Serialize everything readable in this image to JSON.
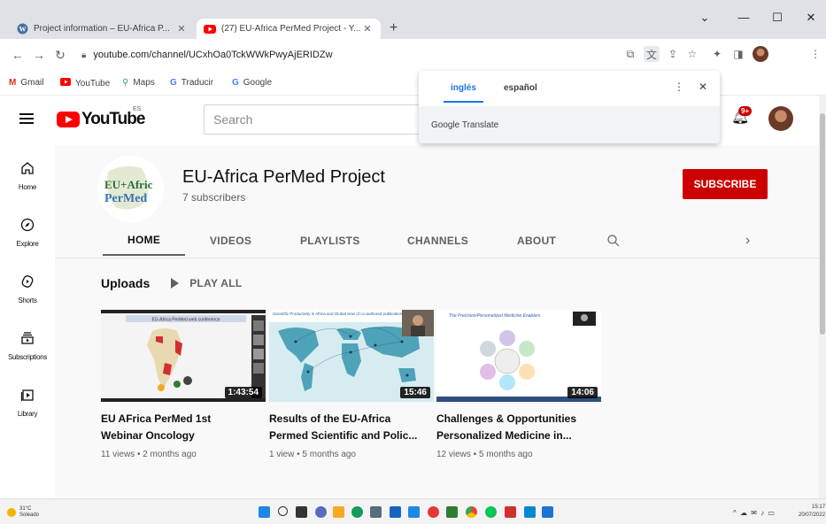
{
  "browser": {
    "tabs": [
      {
        "title": "Project information – EU-Africa P...",
        "active": false
      },
      {
        "title": "(27) EU-Africa PerMed Project - Y...",
        "active": true
      }
    ],
    "new_tab": "+",
    "window_controls": [
      "⌄",
      "—",
      "☐",
      "✕"
    ],
    "url": "youtube.com/channel/UCxhOa0TckWWkPwyAjERIDZw",
    "bookmarks": [
      "Gmail",
      "YouTube",
      "Maps",
      "Traducir",
      "Google"
    ]
  },
  "translate_popup": {
    "tabs": [
      "inglés",
      "español"
    ],
    "selected": "inglés",
    "footer": "Google Translate",
    "menu": "⋮",
    "close": "✕"
  },
  "youtube": {
    "logo_text": "YouTube",
    "country_code": "ES",
    "search_placeholder": "Search",
    "notification_count": "9+",
    "sidebar": [
      {
        "label": "Home",
        "icon": "home-icon"
      },
      {
        "label": "Explore",
        "icon": "compass-icon"
      },
      {
        "label": "Shorts",
        "icon": "shorts-icon"
      },
      {
        "label": "Subscriptions",
        "icon": "subscriptions-icon"
      },
      {
        "label": "Library",
        "icon": "library-icon"
      }
    ],
    "channel": {
      "name": "EU-Africa PerMed Project",
      "subscribers": "7 subscribers",
      "subscribe_label": "SUBSCRIBE",
      "logo_line1": "EU+Afric",
      "logo_line2": "PerMed"
    },
    "tabs": [
      "HOME",
      "VIDEOS",
      "PLAYLISTS",
      "CHANNELS",
      "ABOUT"
    ],
    "selected_tab": "HOME",
    "uploads": {
      "title": "Uploads",
      "play_all": "PLAY ALL",
      "videos": [
        {
          "title1": "EU AFrica PerMed 1st",
          "title2": "Webinar Oncology",
          "meta": "11 views • 2 months ago",
          "duration": "1:43:54",
          "thumb_caption": "EU-Africa PerMed web conference"
        },
        {
          "title1": "Results of the EU-Africa",
          "title2": "Permed Scientific and Polic...",
          "meta": "1 view • 5 months ago",
          "duration": "15:46",
          "thumb_caption": "Scientific Productivity in Africa and Global view of co-authored publications"
        },
        {
          "title1": "Challenges & Opportunities",
          "title2": "Personalized Medicine in...",
          "meta": "12 views • 5 months ago",
          "duration": "14:06",
          "thumb_caption": "The Precision/Personalized Medicine Enablers"
        }
      ]
    }
  },
  "taskbar": {
    "weather_temp": "31°C",
    "weather_desc": "Soleado",
    "time": "15:17",
    "date": "20/07/2022"
  },
  "colors": {
    "youtube_red": "#ff0000",
    "subscribe_red": "#cc0000",
    "translate_blue": "#1a73e8"
  }
}
